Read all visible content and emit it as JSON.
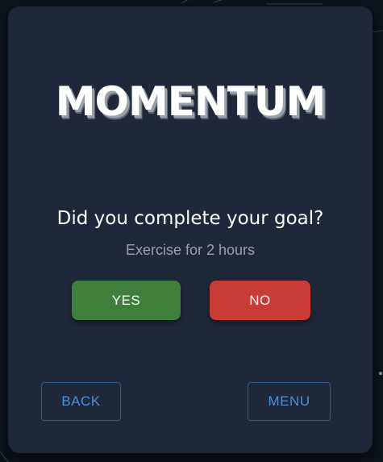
{
  "logo": {
    "text_before": "M",
    "o_letter": "O",
    "text_after": "MENTUM"
  },
  "prompt": {
    "question": "Did you complete your goal?",
    "goal": "Exercise for 2 hours"
  },
  "actions": {
    "yes_label": "YES",
    "no_label": "NO"
  },
  "navigation": {
    "back_label": "BACK",
    "menu_label": "MENU"
  },
  "colors": {
    "panel": "#1f2838",
    "yes": "#3f7f3c",
    "no": "#c83c35",
    "accent": "#4a8fe0"
  }
}
